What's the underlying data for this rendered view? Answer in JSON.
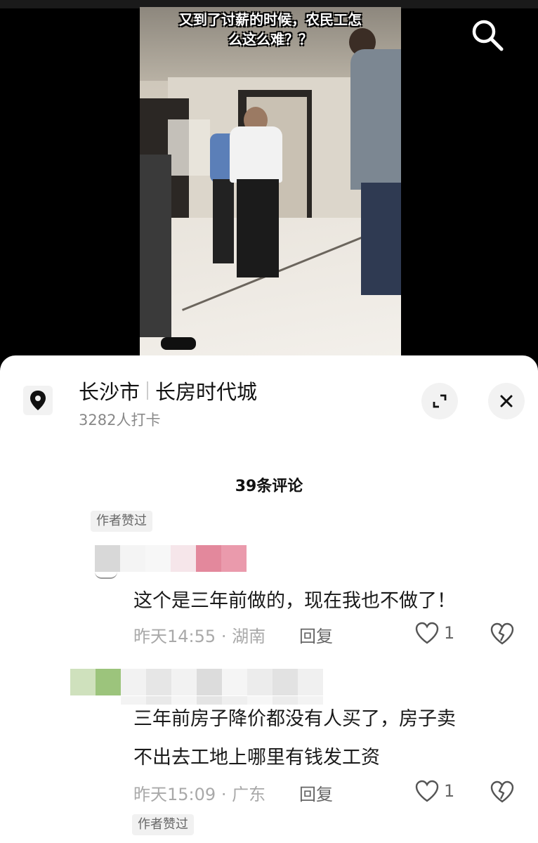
{
  "video": {
    "subtitle": "又到了讨薪的时候，农民工怎\n么这么难？？"
  },
  "header": {
    "location_city": "长沙市",
    "location_place": "长房时代城",
    "checkin_count": "3282人打卡"
  },
  "comments_header": {
    "count_label": "39条评论"
  },
  "comments": [
    {
      "author_liked_tag": "作者赞过",
      "text": "这个是三年前做的，现在我也不做了！",
      "time": "昨天14:55",
      "region": "湖南",
      "reply_label": "回复",
      "likes": "1"
    },
    {
      "text": "三年前房子降价都没有人买了，房子卖\n不出去工地上哪里有钱发工资",
      "time": "昨天15:09",
      "region": "广东",
      "reply_label": "回复",
      "likes": "1",
      "author_liked_tag": "作者赞过"
    }
  ],
  "icons": {
    "search": "search-icon",
    "location": "location-pin-icon",
    "expand": "expand-icon",
    "close": "close-icon",
    "like": "heart-outline-icon",
    "dislike": "broken-heart-icon"
  },
  "colors": {
    "background": "#000000",
    "sheet": "#ffffff",
    "muted_text": "#a9a9a9",
    "tag_bg": "#f1f1f1"
  }
}
